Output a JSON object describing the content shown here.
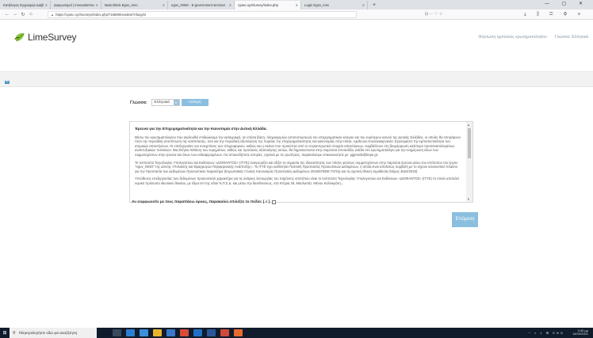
{
  "browser": {
    "tabs": [
      {
        "title": "Κατάλογος Εγγραφών Διαβίωσης",
        "active": false
      },
      {
        "title": "Διαγωνισμοί | InnovationHub",
        "active": false
      },
      {
        "title": "Main Block Egov_Inno",
        "active": false
      },
      {
        "title": "egov_INNO - E-government services",
        "active": false
      },
      {
        "title": "cyasc.xyz/survey/index.php",
        "active": true
      },
      {
        "title": "Login Egov_Inno",
        "active": false
      }
    ],
    "new_tab": "+",
    "window_controls": "— ▢ ✕",
    "url": "https://cyasc.xyz/surveys/index.php/716599/newtest/Y/lang/el",
    "url_actions": "⊡ ··· ♡ ☆",
    "nav_icons": "⤓ ⫼ ◫ ⚙ ≡"
  },
  "site_header": {
    "logo_text": "LimeSurvey",
    "menu": [
      "Φόρτωση ημιτελούς ερωτηματολογίου",
      "Γλώσσα: Ελληνικά"
    ]
  },
  "progress": {
    "badge": "0%",
    "fraction": 0
  },
  "language": {
    "label": "Γλώσσα:",
    "selected": "Ελληνικά",
    "caret": "▾",
    "change_button": "Αλλαγή γλώσσας"
  },
  "survey_text": {
    "title": "Έρευνα για την Επιχειρηματικότητα και την Καινοτομία στην Δυτική Ελλάδα.",
    "paragraphs": [
      "Μέσω του ερωτηματολογίου που ακολουθεί επιδιώκουμε την καταγραφή, σε ετήσια βάση, πληροφοριών (αποτυπώσεων) του επιχειρηματικού κόσμου και του ευρύτερου κοινού της Δυτικής Ελλάδας, οι οποίες θα επιτρέψουν τόσο την περιοδική αποτύπωση της κατάστασης, όσο και την περιοδική αξιολόγηση της πορείας της επιχειρηματικότητας και καινοτομίας στην Ηλεία, Αχαΐα και Αιτωλοακαρνανία. Εγγυόμαστε την εμπιστευτικότητα των ατομικών απαντήσεων. Οι επεξεργασίες και συσχετίσεις των πληροφοριών, καθώς και η εικόνα που προκύπτει από το συγκεντρωτικό στοιχείο απαντήσεων, συμβάλλουν στη διαμόρφωση καλύτερα προσανατολισμένων αναπτυξιακών πολιτικών. Μια Ετήσια Έκθεση των ευρημάτων, καθώς και προτάσεις αξιοποίησης αυτών, θα δημοσιεύονται στην παρούσα ιστοσελίδα. Διτίδα στο ερωτηματολόγιο για την ενημέρωση όλων των συμμετεχόντων στην έρευνα και όλων των ενδιαφερομένων. Για οποιεσδήποτε απορίες, σχετικά με τις ερωτήσεις, παρακαλούμε επικοινωνήστε με: pjgeorde@kepe.gr.",
      "Το Ινστιτούτο Τεχνολογίας Υπολογιστών και Εκδόσεων «ΔΙΟΦΑΝΤΟΣ» (ΙΤΥΕ) αναγνωρίζει και αξίζει τη σημασία της ιδιωτικότητας των πάσης φύσεως συμμετεχόντων στην παρούσα έρευνα μέσω του ιστότοπου του έργου \"egov_INNO\" της Δ/νσης «Πολιτικής και Εφαρμογών Περιφερειακής Ανάπτυξης». Το ΙΤΥΕ έχει υιοθετήσει Πολιτική Προστασίας Προσωπικών Δεδομένων, η οποία είναι απολύτως συμβατή με το ισχύον κανονιστικό πλαίσιο για την Προστασία των Δεδομένων Προσωπικού Χαρακτήρα (Ευρωπαϊκός Γενικός Κανονισμός Προστασίας Δεδομένων 2016/679/ΕΕ ΓΚΠΔ) και τη σχετική εθνική νομοθεσία (Νόμος 4624/2019).",
      "Υπεύθυνος επεξεργασίας των δεδομένων προσωπικού χαρακτήρα για τις ανάγκες λειτουργίας του παρόντος ιστοτόπου είναι το Ινστιτούτο Τεχνολογίας Υπολογιστών και Εκδόσεων «ΔΙΟΦΑΝΤΟΣ» (ΙΤΥΕ) το οποίο αποτελεί νομικό πρόσωπο ιδιωτικού δικαίου, με έδρα επί της οδού Ν.Π.Σ.Δ. και μέσω την διευθύνσεως, στα Κτήρια 26, Μαυλαπάτ, Μένου Καλλικράτη..."
    ],
    "scroll_up": "▲",
    "scroll_down": "▼"
  },
  "consent": {
    "label": "Αν συμφωνείτε με τους παραπάνω όρους, παρακαλώ επιλέξτε το πεδίο: [ √ ]",
    "checked": false
  },
  "next_button": "Επόμενη",
  "taskbar": {
    "start_glyph": "⊞",
    "search_glyph": "⚲",
    "search_placeholder": "Πληκτρολογήστε εδώ για αναζήτηση",
    "apps": [
      {
        "name": "task-view",
        "color": "#3a4a5e"
      },
      {
        "name": "edge",
        "color": "#2d7dd2"
      },
      {
        "name": "ie",
        "color": "#3b8fd8"
      },
      {
        "name": "folder",
        "color": "#e8b32a"
      },
      {
        "name": "store",
        "color": "#3a78c9"
      },
      {
        "name": "chrome",
        "color": "#d94a38"
      },
      {
        "name": "mail",
        "color": "#1f6fc5"
      },
      {
        "name": "word",
        "color": "#2b579a"
      },
      {
        "name": "app-red",
        "color": "#d04a3a"
      },
      {
        "name": "firefox",
        "color": "#e66a2c"
      }
    ],
    "tray_icons": "^ ⌂ ◖ ⊞ ENG",
    "time": "3:40 μμ",
    "date": "14/09/2021"
  }
}
